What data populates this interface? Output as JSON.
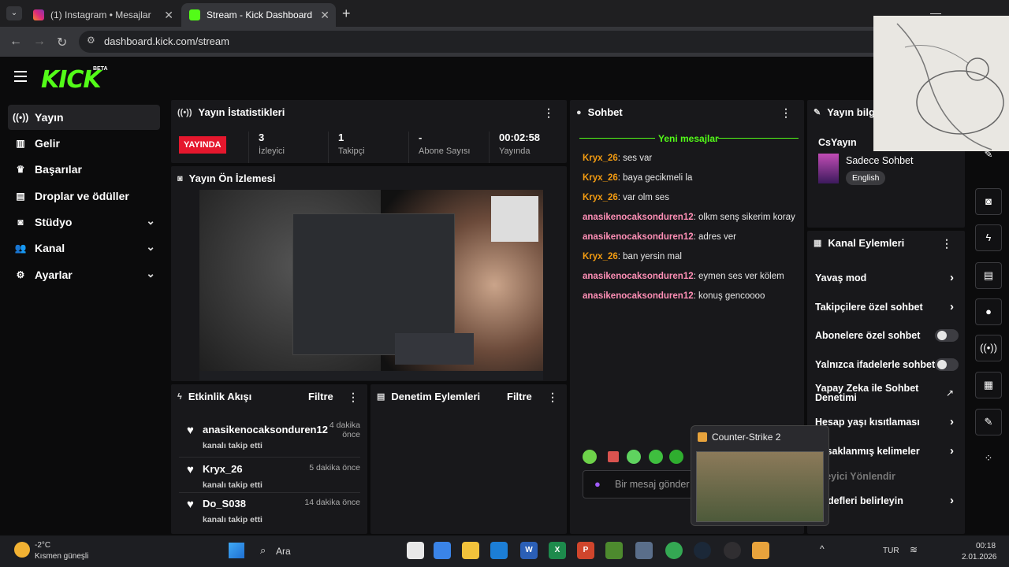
{
  "browser": {
    "tabs": [
      {
        "label": "(1) Instagram • Mesajlar",
        "active": false
      },
      {
        "label": "Stream - Kick Dashboard",
        "active": true
      }
    ],
    "url": "dashboard.kick.com/stream"
  },
  "brand": {
    "logo": "KICK",
    "badge": "BETA",
    "accent": "#53fc18"
  },
  "sidebar": {
    "items": [
      {
        "label": "Yayın",
        "icon": "broadcast-icon",
        "active": true
      },
      {
        "label": "Gelir",
        "icon": "chart-icon"
      },
      {
        "label": "Başarılar",
        "icon": "trophy-icon"
      },
      {
        "label": "Droplar ve ödüller",
        "icon": "gift-icon"
      },
      {
        "label": "Stüdyo",
        "icon": "studio-icon",
        "expandable": true
      },
      {
        "label": "Kanal",
        "icon": "users-icon",
        "expandable": true
      },
      {
        "label": "Ayarlar",
        "icon": "gear-icon",
        "expandable": true
      }
    ]
  },
  "stats": {
    "title": "Yayın İstatistikleri",
    "live_badge": "YAYINDA",
    "items": [
      {
        "value": "3",
        "label": "İzleyici"
      },
      {
        "value": "1",
        "label": "Takipçi"
      },
      {
        "value": "-",
        "label": "Abone Sayısı"
      },
      {
        "value": "00:02:58",
        "label": "Yayında"
      }
    ]
  },
  "preview": {
    "title": "Yayın Ön İzlemesi"
  },
  "activity": {
    "title": "Etkinlik Akışı",
    "filter": "Filtre",
    "events": [
      {
        "name": "anasikenocaksonduren12",
        "sub": "kanalı takip etti",
        "time": "4 dakika önce"
      },
      {
        "name": "Kryx_26",
        "sub": "kanalı takip etti",
        "time": "5 dakika önce"
      },
      {
        "name": "Do_S038",
        "sub": "kanalı takip etti",
        "time": "14 dakika önce"
      }
    ]
  },
  "moderation": {
    "title": "Denetim Eylemleri",
    "filter": "Filtre"
  },
  "chat": {
    "title": "Sohbet",
    "new_messages": "Yeni mesajlar",
    "messages": [
      {
        "user": "Kryx_26",
        "text": "ses var",
        "color": "#f39c12"
      },
      {
        "user": "Kryx_26",
        "text": "baya gecikmeli la",
        "color": "#f39c12"
      },
      {
        "user": "Kryx_26",
        "text": "var olm ses",
        "color": "#f39c12"
      },
      {
        "user": "anasikenocaksonduren12",
        "text": "olkm senş sikerim koray",
        "color": "#ff8fb6"
      },
      {
        "user": "anasikenocaksonduren12",
        "text": "adres ver",
        "color": "#ff8fb6"
      },
      {
        "user": "Kryx_26",
        "text": "ban yersin mal",
        "color": "#f39c12"
      },
      {
        "user": "anasikenocaksonduren12",
        "text": "eymen ses ver kölem",
        "color": "#ff8fb6"
      },
      {
        "user": "anasikenocaksonduren12",
        "text": "konuş gencoooo",
        "color": "#ff8fb6"
      }
    ],
    "input_placeholder": "Bir mesaj gönder"
  },
  "stream_info": {
    "title": "Yayın bilgi",
    "channel": "CsYayın",
    "category": "Sadece Sohbet",
    "language": "English"
  },
  "channel_actions": {
    "title": "Kanal Eylemleri",
    "items": [
      {
        "label": "Yavaş mod",
        "type": "chevron"
      },
      {
        "label": "Takipçilere özel sohbet",
        "type": "chevron"
      },
      {
        "label": "Abonelere özel sohbet",
        "type": "toggle"
      },
      {
        "label": "Yalnızca ifadelerle sohbet",
        "type": "toggle"
      },
      {
        "label": "Yapay Zeka ile Sohbet Denetimi",
        "type": "external"
      },
      {
        "label": "Hesap yaşı kısıtlaması",
        "type": "chevron"
      },
      {
        "label": "Yasaklanmış kelimeler",
        "type": "chevron"
      },
      {
        "label": "İzleyici Yönlendir",
        "type": "none"
      },
      {
        "label": "Hedefleri belirleyin",
        "type": "chevron"
      }
    ]
  },
  "taskbar_popup": {
    "title": "Counter-Strike 2"
  },
  "taskbar": {
    "weather_temp": "-2°C",
    "weather_desc": "Kısmen güneşli",
    "search": "Ara",
    "lang": "TUR",
    "time": "00:18",
    "date": "2.01.2026"
  }
}
